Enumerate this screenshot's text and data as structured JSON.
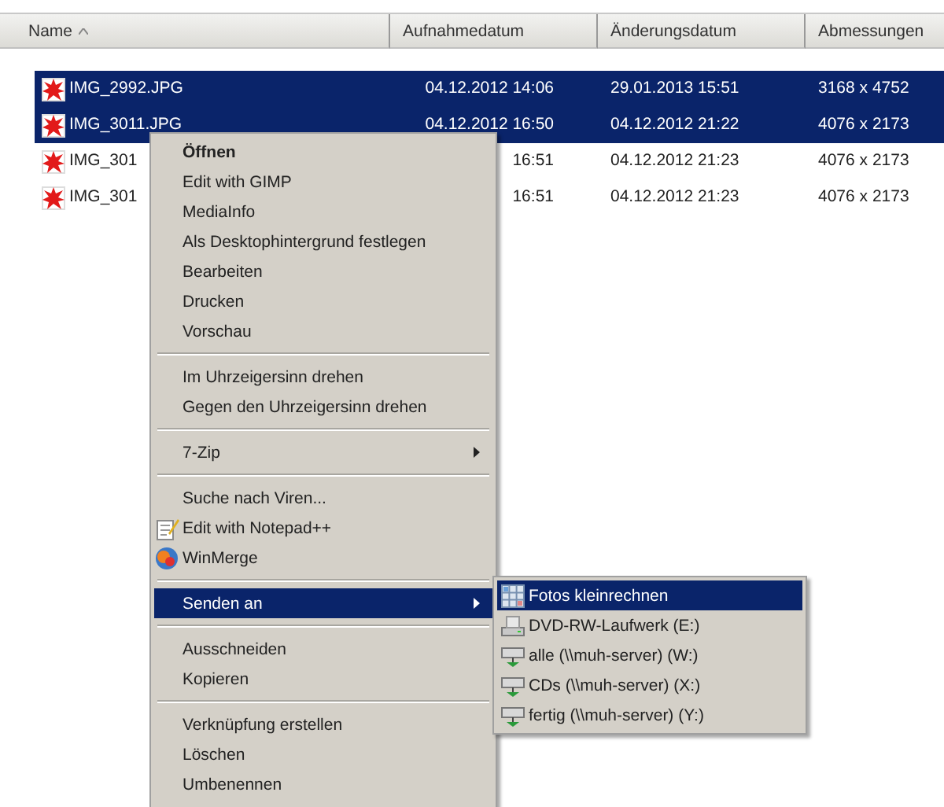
{
  "columns": [
    {
      "label": "Name",
      "sorted": true
    },
    {
      "label": "Aufnahmedatum",
      "sorted": false
    },
    {
      "label": "Änderungsdatum",
      "sorted": false
    },
    {
      "label": "Abmessungen",
      "sorted": false
    }
  ],
  "files": [
    {
      "name": "IMG_2992.JPG",
      "date_taken": "04.12.2012 14:06",
      "date_modified": "29.01.2013 15:51",
      "dimensions": "3168 x 4752",
      "selected": true
    },
    {
      "name": "IMG_3011.JPG",
      "date_taken": "04.12.2012 16:50",
      "date_modified": "04.12.2012 21:22",
      "dimensions": "4076 x 2173",
      "selected": true
    },
    {
      "name": "IMG_301",
      "date_taken": "16:51",
      "date_modified": "04.12.2012 21:23",
      "dimensions": "4076 x 2173",
      "selected": false
    },
    {
      "name": "IMG_301",
      "date_taken": "16:51",
      "date_modified": "04.12.2012 21:23",
      "dimensions": "4076 x 2173",
      "selected": false
    }
  ],
  "context_menu": {
    "groups": [
      [
        {
          "label": "Öffnen",
          "kind": "plain",
          "default": true,
          "submenu": false,
          "selected": false
        },
        {
          "label": "Edit with GIMP",
          "kind": "plain",
          "default": false,
          "submenu": false,
          "selected": false
        },
        {
          "label": "MediaInfo",
          "kind": "plain",
          "default": false,
          "submenu": false,
          "selected": false
        },
        {
          "label": "Als Desktophintergrund festlegen",
          "kind": "plain",
          "default": false,
          "submenu": false,
          "selected": false
        },
        {
          "label": "Bearbeiten",
          "kind": "plain",
          "default": false,
          "submenu": false,
          "selected": false
        },
        {
          "label": "Drucken",
          "kind": "plain",
          "default": false,
          "submenu": false,
          "selected": false
        },
        {
          "label": "Vorschau",
          "kind": "plain",
          "default": false,
          "submenu": false,
          "selected": false
        }
      ],
      [
        {
          "label": "Im Uhrzeigersinn drehen",
          "kind": "plain",
          "default": false,
          "submenu": false,
          "selected": false
        },
        {
          "label": "Gegen den Uhrzeigersinn drehen",
          "kind": "plain",
          "default": false,
          "submenu": false,
          "selected": false
        }
      ],
      [
        {
          "label": "7-Zip",
          "kind": "plain",
          "default": false,
          "submenu": true,
          "selected": false
        }
      ],
      [
        {
          "label": "Suche nach Viren...",
          "kind": "plain",
          "default": false,
          "submenu": false,
          "selected": false
        },
        {
          "label": "Edit with Notepad++",
          "kind": "notepad",
          "default": false,
          "submenu": false,
          "selected": false
        },
        {
          "label": "WinMerge",
          "kind": "winmerge",
          "default": false,
          "submenu": false,
          "selected": false
        }
      ],
      [
        {
          "label": "Senden an",
          "kind": "plain",
          "default": false,
          "submenu": true,
          "selected": true
        }
      ],
      [
        {
          "label": "Ausschneiden",
          "kind": "plain",
          "default": false,
          "submenu": false,
          "selected": false
        },
        {
          "label": "Kopieren",
          "kind": "plain",
          "default": false,
          "submenu": false,
          "selected": false
        }
      ],
      [
        {
          "label": "Verknüpfung erstellen",
          "kind": "plain",
          "default": false,
          "submenu": false,
          "selected": false
        },
        {
          "label": "Löschen",
          "kind": "plain",
          "default": false,
          "submenu": false,
          "selected": false
        },
        {
          "label": "Umbenennen",
          "kind": "plain",
          "default": false,
          "submenu": false,
          "selected": false
        }
      ]
    ]
  },
  "submenu": {
    "items": [
      {
        "label": "Fotos kleinrechnen",
        "kind": "grid",
        "selected": true
      },
      {
        "label": "DVD-RW-Laufwerk (E:)",
        "kind": "drive",
        "selected": false
      },
      {
        "label": "alle (\\\\muh-server) (W:)",
        "kind": "network",
        "selected": false
      },
      {
        "label": "CDs (\\\\muh-server) (X:)",
        "kind": "network",
        "selected": false
      },
      {
        "label": "fertig (\\\\muh-server) (Y:)",
        "kind": "network",
        "selected": false
      }
    ]
  }
}
